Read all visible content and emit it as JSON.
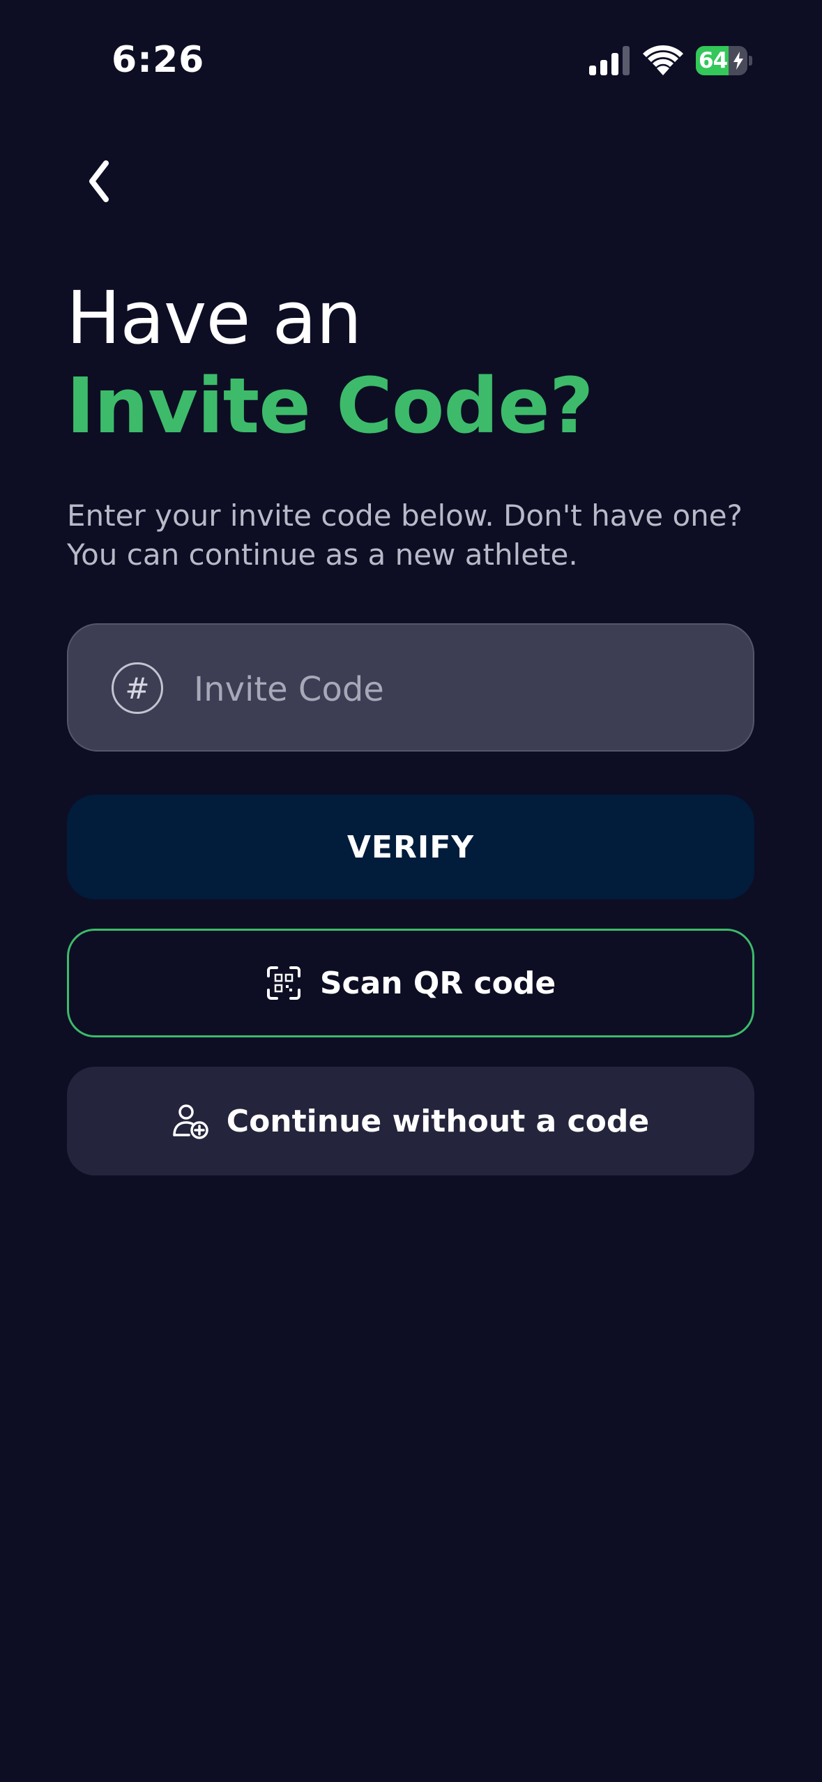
{
  "status_bar": {
    "time": "6:26",
    "battery_level": "64",
    "battery_fraction": 0.64,
    "signal_icon": "cellular-signal-icon",
    "wifi_icon": "wifi-icon",
    "charging_icon": "bolt-icon"
  },
  "nav": {
    "back_icon": "chevron-left-icon"
  },
  "heading": {
    "line1": "Have an",
    "line2": "Invite Code?"
  },
  "subtitle": "Enter your invite code below. Don't have one? You can continue as a new athlete.",
  "invite_field": {
    "icon_glyph": "#",
    "icon": "hash-icon",
    "placeholder": "Invite Code",
    "value": ""
  },
  "buttons": {
    "verify_label": "VERIFY",
    "scan_label": "Scan QR code",
    "scan_icon": "qr-scan-icon",
    "continue_label": "Continue without a code",
    "continue_icon": "add-user-icon"
  },
  "colors": {
    "background": "#0d0e24",
    "accent_green": "#3dbb6a",
    "verify_bg": "#021c3b",
    "field_bg": "#3d3e54",
    "secondary_button_bg": "#24253c",
    "battery_green": "#34c759"
  }
}
